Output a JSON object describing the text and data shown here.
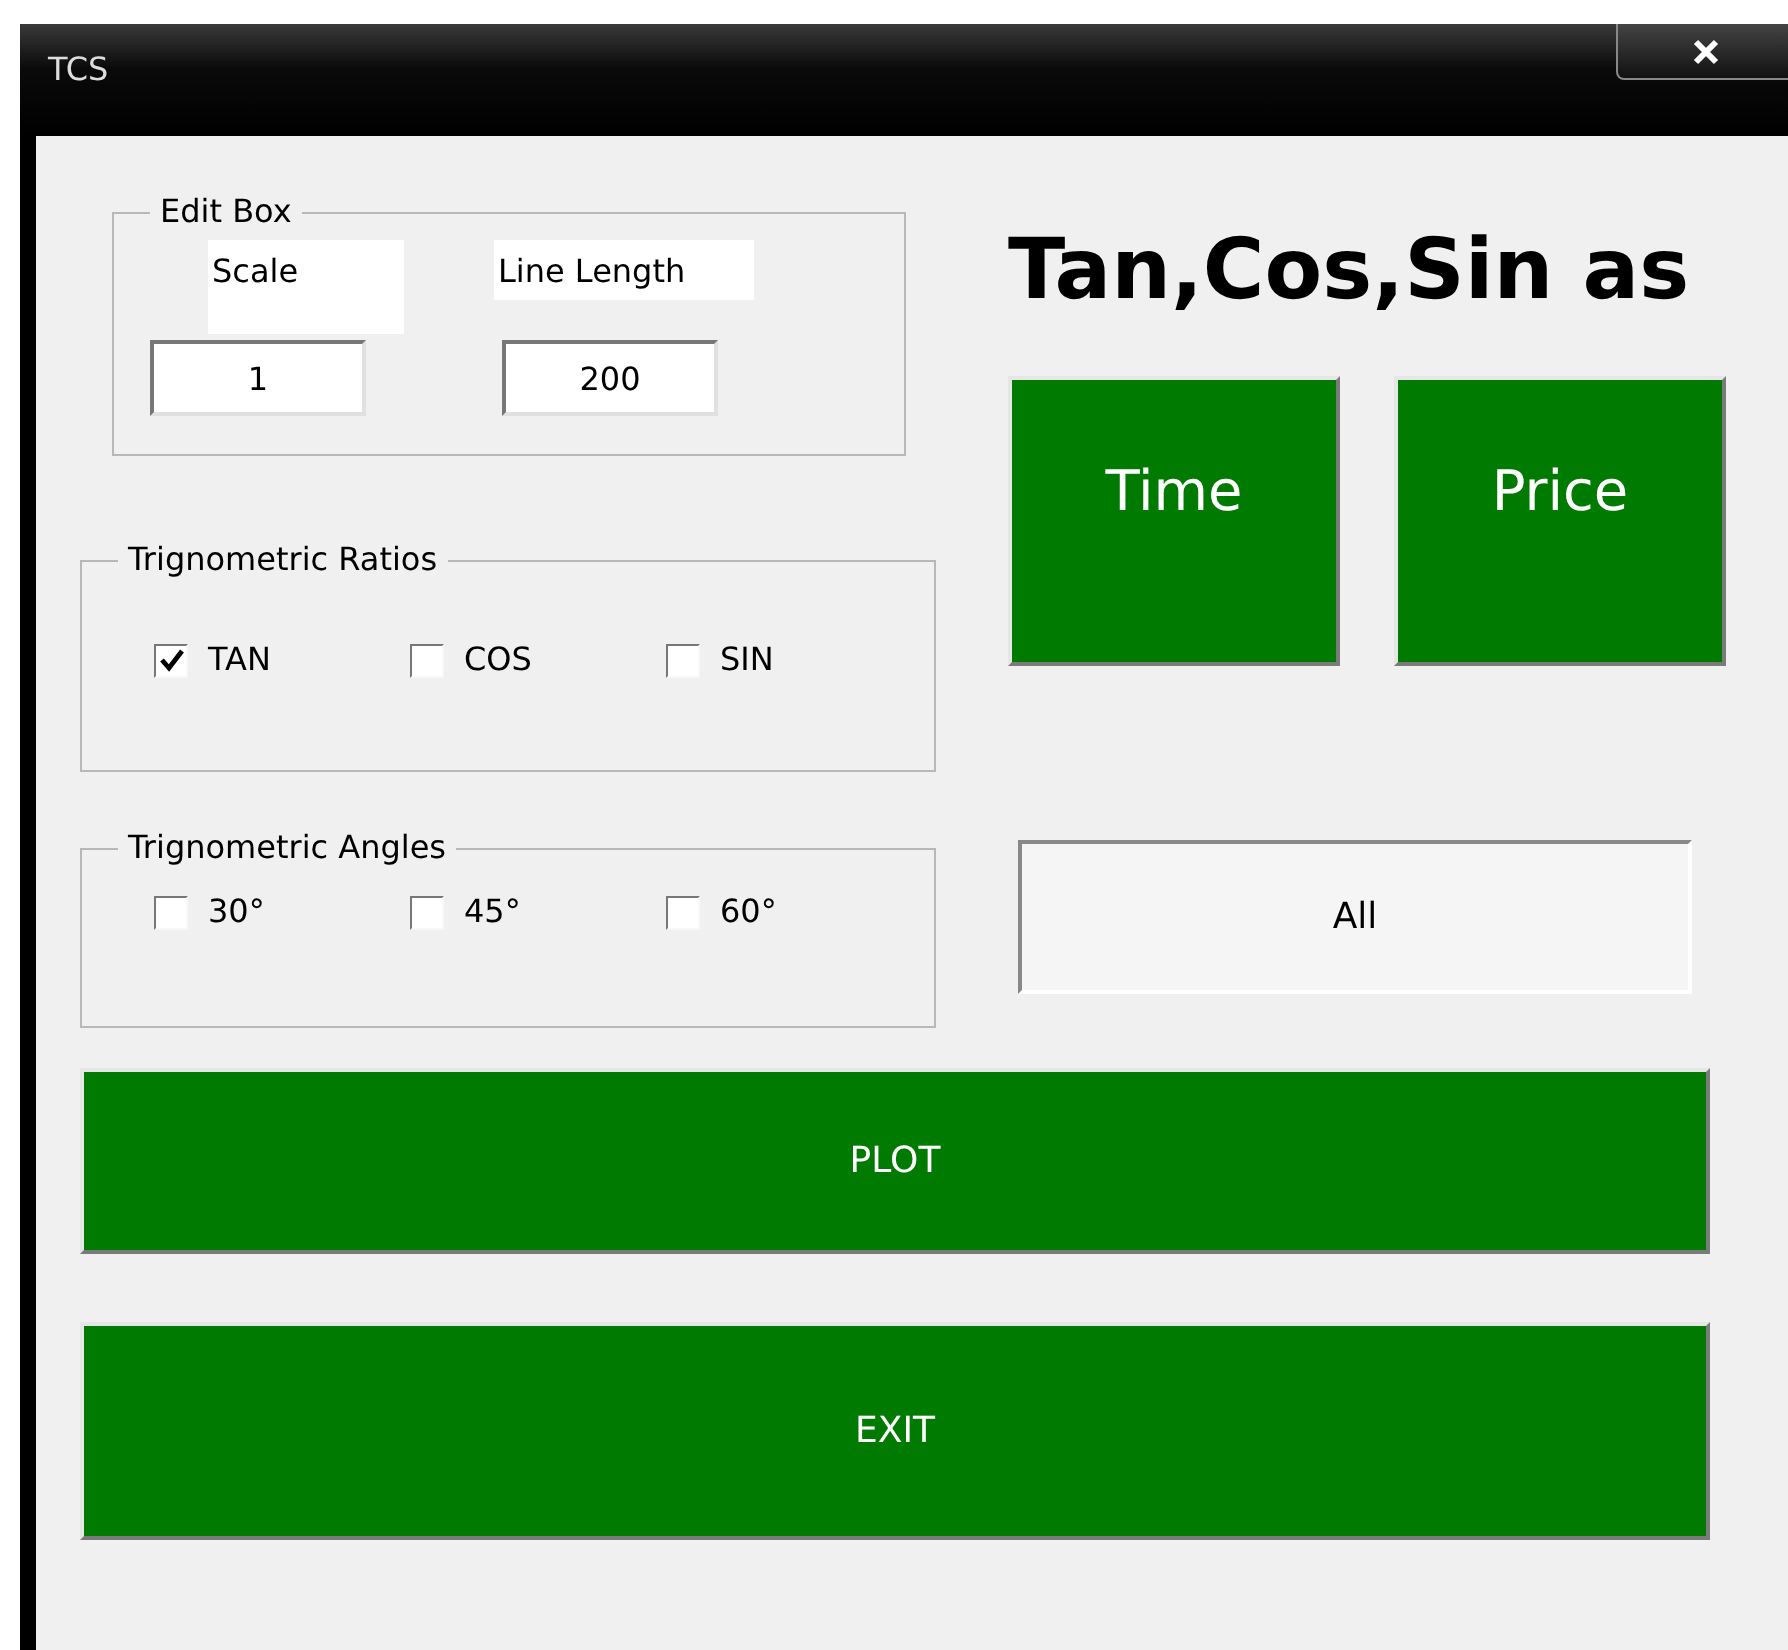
{
  "window": {
    "title": "TCS"
  },
  "edit_box": {
    "title": "Edit Box",
    "fields": [
      {
        "label": "Scale",
        "value": "1"
      },
      {
        "label": "Line Length",
        "value": "200"
      }
    ]
  },
  "heading": "Tan,Cos,Sin as",
  "mode_buttons": [
    {
      "label": "Time"
    },
    {
      "label": "Price"
    }
  ],
  "ratios": {
    "title": "Trignometric Ratios",
    "options": [
      {
        "label": "TAN",
        "checked": true
      },
      {
        "label": "COS",
        "checked": false
      },
      {
        "label": "SIN",
        "checked": false
      }
    ]
  },
  "angles": {
    "title": "Trignometric Angles",
    "options": [
      {
        "label": "30°",
        "checked": false
      },
      {
        "label": "45°",
        "checked": false
      },
      {
        "label": "60°",
        "checked": false
      }
    ]
  },
  "all_button": "All",
  "plot_button": "PLOT",
  "exit_button": "EXIT"
}
